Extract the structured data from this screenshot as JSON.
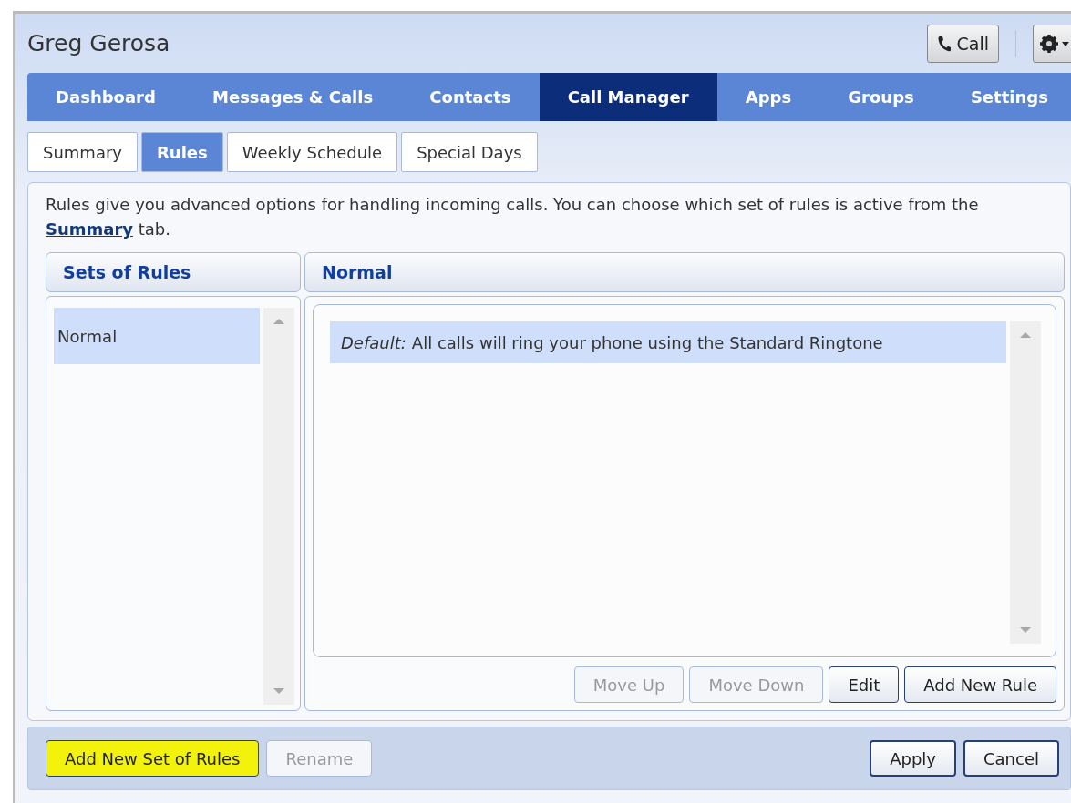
{
  "window": {
    "title": "Greg Gerosa",
    "call_button": "Call"
  },
  "nav_tabs": [
    {
      "label": "Dashboard",
      "selected": false
    },
    {
      "label": "Messages & Calls",
      "selected": false
    },
    {
      "label": "Contacts",
      "selected": false
    },
    {
      "label": "Call Manager",
      "selected": true
    },
    {
      "label": "Apps",
      "selected": false
    },
    {
      "label": "Groups",
      "selected": false
    },
    {
      "label": "Settings",
      "selected": false
    }
  ],
  "sub_tabs": [
    {
      "label": "Summary",
      "selected": false
    },
    {
      "label": "Rules",
      "selected": true
    },
    {
      "label": "Weekly Schedule",
      "selected": false
    },
    {
      "label": "Special Days",
      "selected": false
    }
  ],
  "intro": {
    "text": "Rules give you advanced options for handling incoming calls. You can choose which set of rules is active from the",
    "link": "Summary",
    "after": "tab."
  },
  "sets_panel": {
    "heading": "Sets of Rules",
    "items": [
      {
        "label": "Normal",
        "selected": true
      }
    ]
  },
  "rules_panel": {
    "heading": "Normal",
    "rules": [
      {
        "prefix": "Default:",
        "text": "All calls will ring your phone using the Standard Ringtone",
        "selected": true
      }
    ],
    "buttons": [
      {
        "label": "Move Up",
        "disabled": true
      },
      {
        "label": "Move Down",
        "disabled": true
      },
      {
        "label": "Edit",
        "disabled": false
      },
      {
        "label": "Add New Rule",
        "disabled": false
      }
    ]
  },
  "footer": {
    "left_buttons": [
      {
        "label": "Add New Set of Rules",
        "disabled": false,
        "highlighted": true
      },
      {
        "label": "Rename",
        "disabled": true,
        "highlighted": false
      }
    ],
    "right_buttons": [
      {
        "label": "Apply",
        "disabled": false
      },
      {
        "label": "Cancel",
        "disabled": false
      }
    ]
  }
}
